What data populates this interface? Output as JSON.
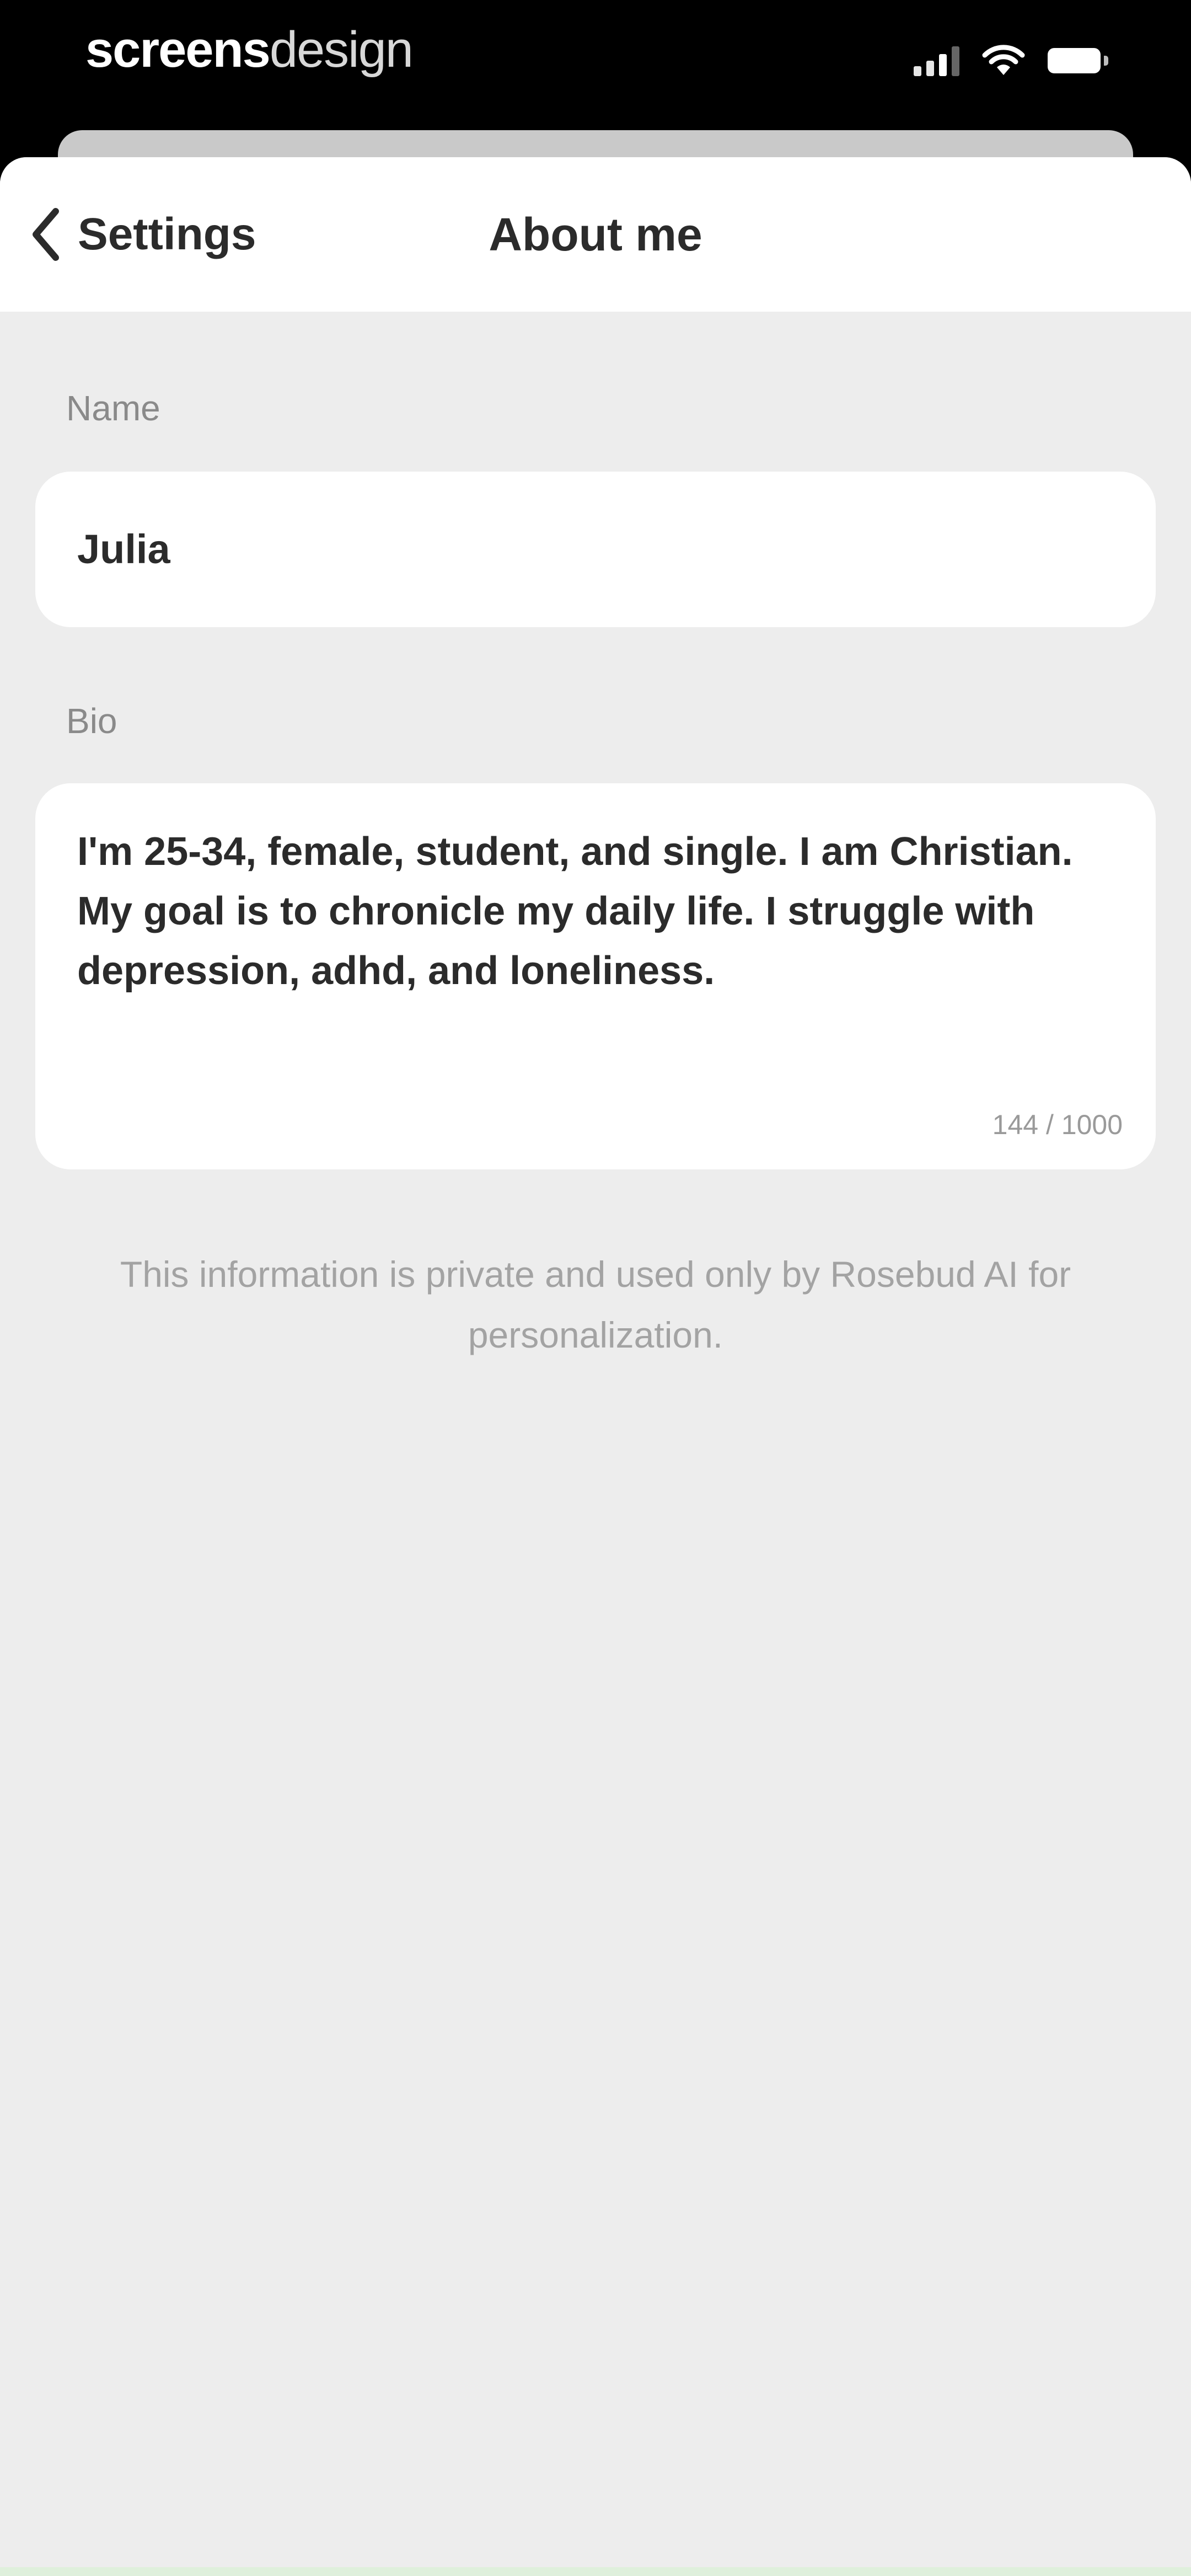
{
  "status_bar": {
    "watermark_bold": "screens",
    "watermark_light": "design",
    "icons": [
      "signal-icon",
      "wifi-icon",
      "battery-icon"
    ]
  },
  "nav": {
    "back_label": "Settings",
    "back_icon": "chevron-left-icon",
    "title": "About me"
  },
  "form": {
    "name_label": "Name",
    "name_value": "Julia",
    "bio_label": "Bio",
    "bio_value": "I'm 25-34, female, student, and single. I am Christian. My goal is to chronicle my daily life. I struggle with depression, adhd, and loneliness.",
    "bio_counter": "144 / 1000"
  },
  "footer_note": "This information is private and used only by Rosebud AI for personalization.",
  "colors": {
    "background": "#ededed",
    "card": "#ffffff",
    "text": "#2b2b2b",
    "muted": "#8a8a8a"
  }
}
